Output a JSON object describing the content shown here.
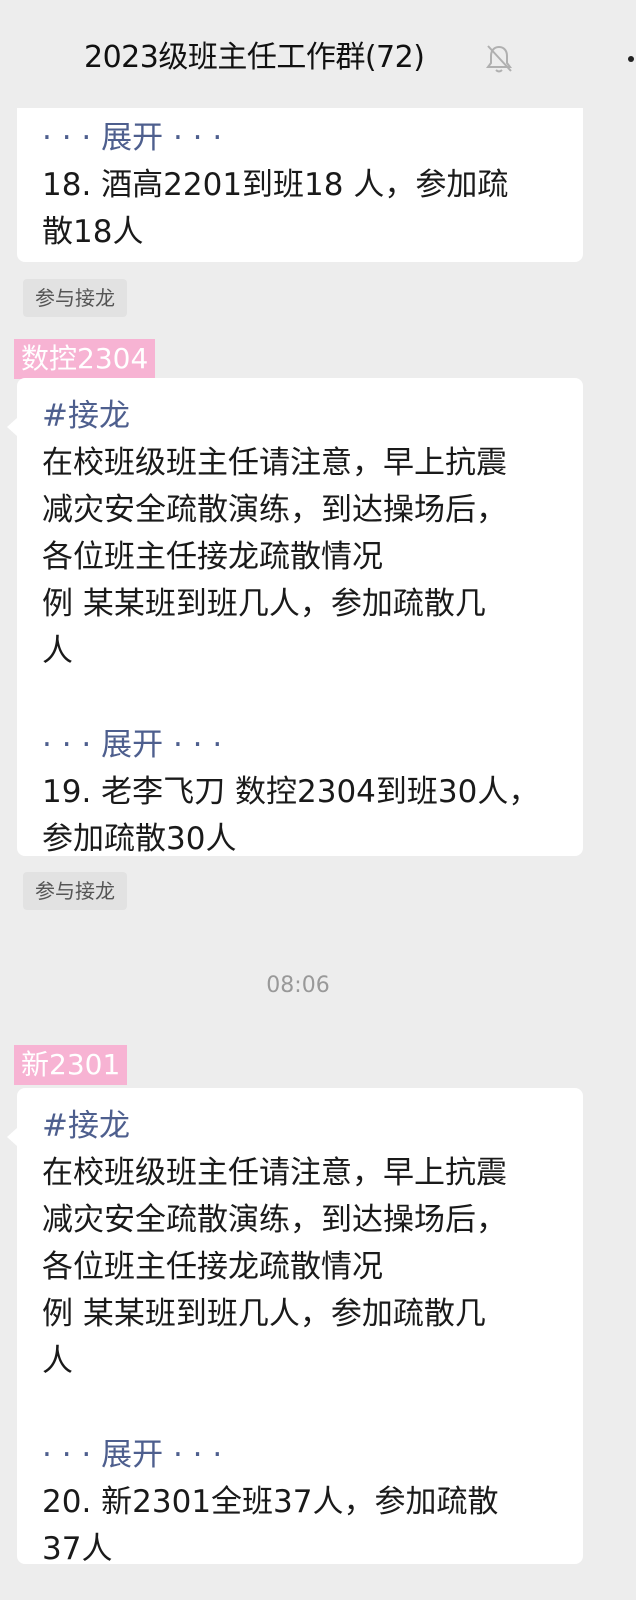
{
  "header": {
    "title": "2023级班主任工作群(72)",
    "mute_icon": "bell-muted-icon",
    "more_icon": "more-icon"
  },
  "messages": [
    {
      "expand": "· · · 展开 · · ·",
      "lines": [
        "18. 酒高2201到班18 人，参加疏",
        "散18人"
      ],
      "join_label": "参与接龙"
    },
    {
      "sender": "数控2304",
      "hashtag": "#接龙",
      "body": [
        "在校班级班主任请注意，早上抗震",
        "减灾安全疏散演练，到达操场后，",
        "各位班主任接龙疏散情况",
        "例 某某班到班几人，参加疏散几",
        "人"
      ],
      "expand": "· · · 展开 · · ·",
      "lines": [
        "19. 老李飞刀 数控2304到班30人，",
        "参加疏散30人"
      ],
      "join_label": "参与接龙"
    },
    {
      "timestamp": "08:06",
      "sender": "新2301",
      "hashtag": "#接龙",
      "body": [
        "在校班级班主任请注意，早上抗震",
        "减灾安全疏散演练，到达操场后，",
        "各位班主任接龙疏散情况",
        "例 某某班到班几人，参加疏散几",
        "人"
      ],
      "expand": "· · · 展开 · · ·",
      "lines": [
        "20. 新2301全班37人，参加疏散",
        "37人"
      ]
    }
  ],
  "colors": {
    "background": "#ededed",
    "bubble": "#ffffff",
    "link_blue": "#4e5f8e",
    "sender_tag_pink": "#f7b3d3"
  }
}
